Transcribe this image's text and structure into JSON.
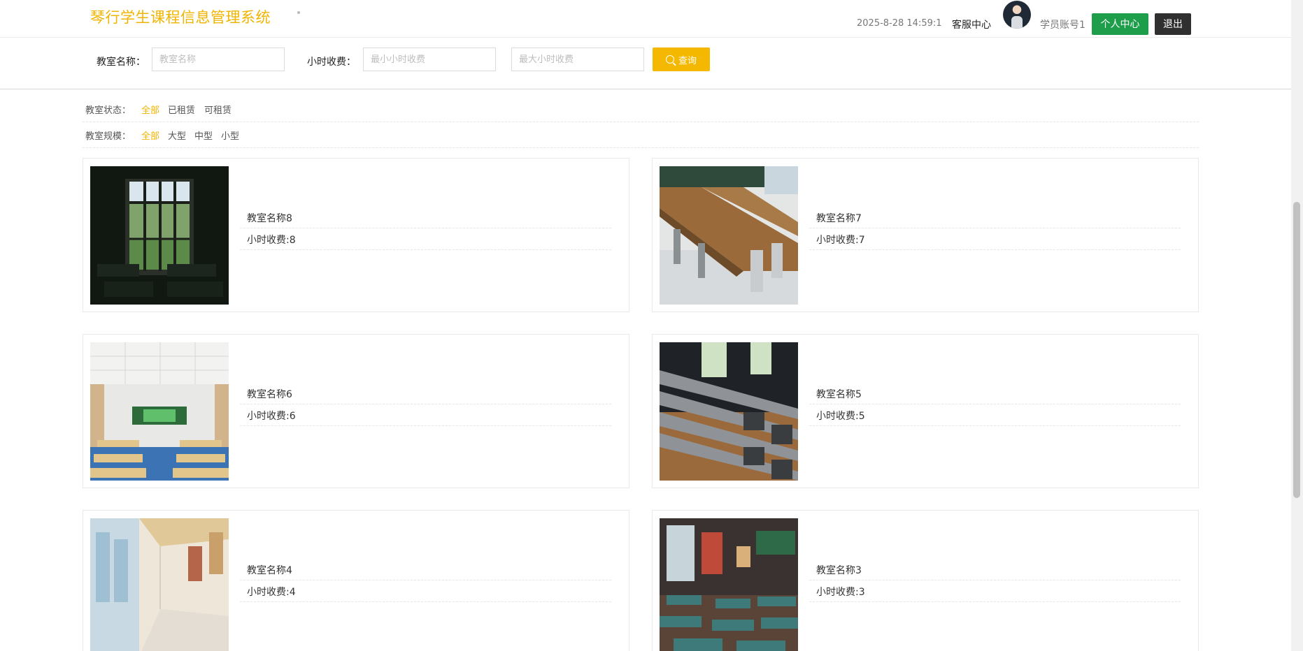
{
  "header": {
    "app_title": "琴行学生课程信息管理系统",
    "datetime": "2025-8-28 14:59:1",
    "support_link": "客服中心",
    "user_name": "学员账号1",
    "personal_center_button": "个人中心",
    "logout_button": "退出"
  },
  "search": {
    "classroom_name_label": "教室名称：",
    "classroom_name_placeholder": "教室名称",
    "hourly_fee_label": "小时收费：",
    "min_fee_placeholder": "最小小时收费",
    "max_fee_placeholder": "最大小时收费",
    "query_button": "查询"
  },
  "filters": {
    "status": {
      "label": "教室状态：",
      "options": [
        "全部",
        "已租赁",
        "可租赁"
      ],
      "selected": "全部"
    },
    "scale": {
      "label": "教室规模：",
      "options": [
        "全部",
        "大型",
        "中型",
        "小型"
      ],
      "selected": "全部"
    }
  },
  "classrooms": [
    {
      "name": "教室名称8",
      "fee": "小时收费:8",
      "image": "dark-classroom-window-photo"
    },
    {
      "name": "教室名称7",
      "fee": "小时收费:7",
      "image": "wooden-desks-row-photo"
    },
    {
      "name": "教室名称6",
      "fee": "小时收费:6",
      "image": "classroom-green-board-photo"
    },
    {
      "name": "教室名称5",
      "fee": "小时收费:5",
      "image": "lecture-hall-seats-photo"
    },
    {
      "name": "教室名称4",
      "fee": "小时收费:4",
      "image": "school-corridor-photo"
    },
    {
      "name": "教室名称3",
      "fee": "小时收费:3",
      "image": "traditional-classroom-photo"
    }
  ],
  "colors": {
    "brand": "#f0b400",
    "search_button": "#f5b800",
    "personal_center": "#1e9e4a",
    "logout": "#2f2f2f"
  }
}
